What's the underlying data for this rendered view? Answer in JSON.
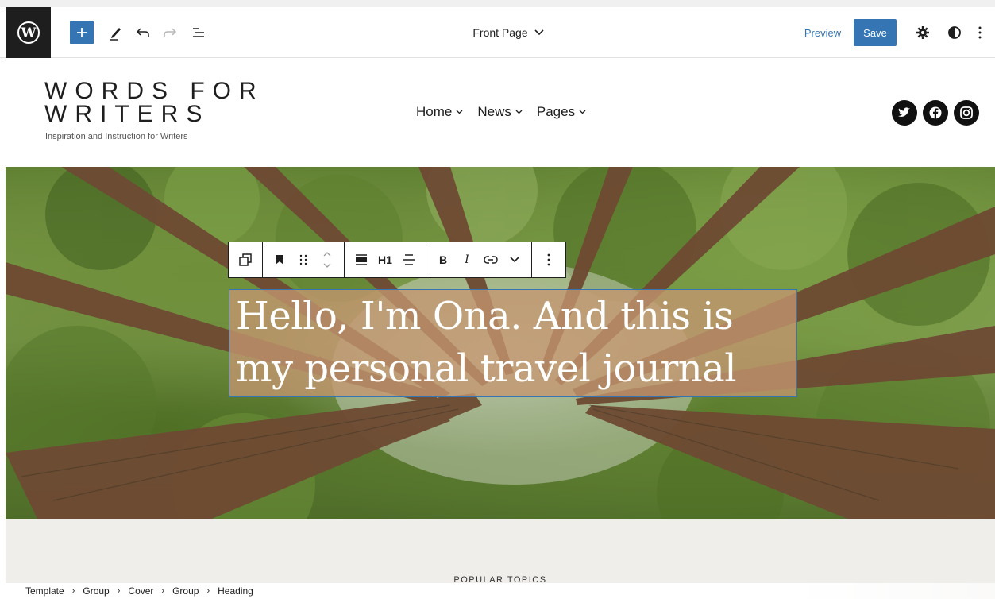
{
  "editor": {
    "document_title": "Front Page",
    "preview_label": "Preview",
    "save_label": "Save"
  },
  "site": {
    "title_line1": "WORDS FOR",
    "title_line2": "WRITERS",
    "tagline": "Inspiration and Instruction for Writers",
    "nav": [
      {
        "label": "Home"
      },
      {
        "label": "News"
      },
      {
        "label": "Pages"
      }
    ],
    "social_icons": [
      "twitter-icon",
      "facebook-icon",
      "instagram-icon"
    ]
  },
  "block_toolbar": {
    "heading_level": "H1",
    "bold": "B",
    "italic": "I"
  },
  "cover": {
    "heading": "Hello, I'm Ona. And this is my personal travel journal",
    "heading_line1": "Hello, I'm Ona. And this is",
    "heading_line2": "my personal travel journal"
  },
  "section": {
    "label": "POPULAR TOPICS"
  },
  "breadcrumb": [
    "Template",
    "Group",
    "Cover",
    "Group",
    "Heading"
  ],
  "colors": {
    "accent": "#3575b3",
    "wp_dark": "#1e1e1e",
    "heading_highlight": "#c49670",
    "below_bg": "#f0eeeb"
  }
}
